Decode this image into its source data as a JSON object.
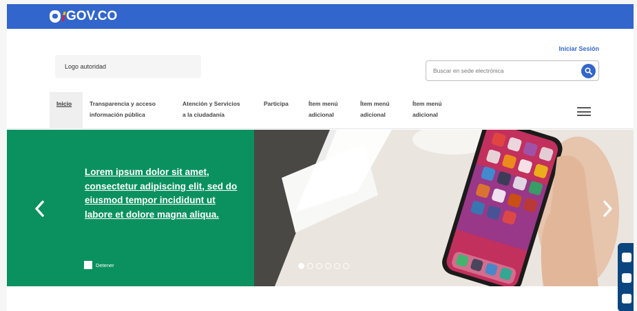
{
  "gov_bar": {
    "logo_text": "GOV.CO"
  },
  "header": {
    "login_label": "Iniciar Sesión",
    "authority_logo_text": "Logo autoridad",
    "search": {
      "placeholder": "Buscar en sede electrónica",
      "value": ""
    }
  },
  "nav": {
    "items": [
      {
        "line1": "Inicio",
        "line2": ""
      },
      {
        "line1": "Transparencia y acceso",
        "line2": "información pública"
      },
      {
        "line1": "Atención y Servicios",
        "line2": "a la ciudadanía"
      },
      {
        "line1": "Participa",
        "line2": ""
      },
      {
        "line1": "Ítem menú",
        "line2": "adicional"
      },
      {
        "line1": "Ítem menú",
        "line2": "adicional"
      },
      {
        "line1": "Ítem menú",
        "line2": "adicional"
      }
    ]
  },
  "hero": {
    "title": "Lorem ipsum dolor sit amet, consectetur adipiscing elit, sed do eiusmod tempor incididunt ut labore et dolore magna aliqua.",
    "stop_label": "Detener",
    "slides_total": 6,
    "active_slide": 1
  },
  "colors": {
    "gov_blue": "#3366cc",
    "hero_green": "#0a915f",
    "accessibility_bar": "#0b457f"
  },
  "icons": [
    "gov-shield-icon",
    "search-icon",
    "menu-icon",
    "chevron-left-icon",
    "chevron-right-icon",
    "contrast-icon",
    "text-size-down-icon",
    "text-size-up-icon"
  ]
}
